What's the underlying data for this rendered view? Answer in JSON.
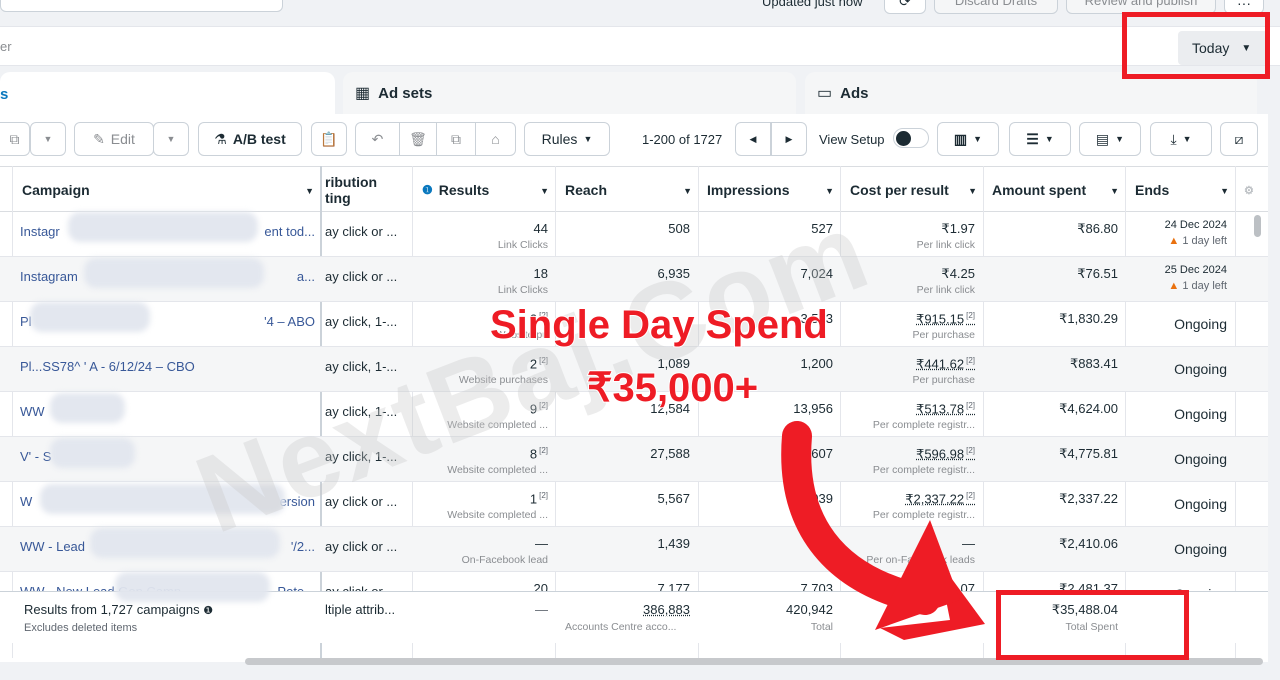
{
  "topbar": {
    "updated_text": "Updated just now",
    "discard_label": "Discard Drafts",
    "review_label": "Review and publish",
    "more_label": "···"
  },
  "filter": {
    "placeholder_fragment": "er",
    "date_label": "Today"
  },
  "tabs": {
    "campaigns_label": "s",
    "adsets_label": "Ad sets",
    "ads_label": "Ads"
  },
  "toolbar": {
    "edit_label": "Edit",
    "ab_test_label": "A/B test",
    "rules_label": "Rules",
    "pagination": "1-200 of 1727",
    "view_setup_label": "View Setup"
  },
  "columns": {
    "campaign": "Campaign",
    "attribution_line1": "ribution",
    "attribution_line2": "ting",
    "results": "Results",
    "reach": "Reach",
    "impressions": "Impressions",
    "cost_per_result": "Cost per result",
    "amount_spent": "Amount spent",
    "ends": "Ends"
  },
  "rows": [
    {
      "name": "Instagr",
      "name_tail": "ent tod...",
      "attr": "ay click or ...",
      "results": "44",
      "results_sub": "Link Clicks",
      "reach": "508",
      "impressions": "527",
      "cpr": "₹1.97",
      "cpr_sub": "Per link click",
      "spent": "₹86.80",
      "ends_date": "24 Dec 2024",
      "ends_left": "1 day left"
    },
    {
      "name": "Instagram",
      "name_tail": "a...",
      "attr": "ay click or ...",
      "results": "18",
      "results_sub": "Link Clicks",
      "reach": "6,935",
      "impressions": "7,024",
      "cpr": "₹4.25",
      "cpr_sub": "Per link click",
      "spent": "₹76.51",
      "ends_date": "25 Dec 2024",
      "ends_left": "1 day left"
    },
    {
      "name": "Pl",
      "name_tail": "'4 – ABO",
      "attr": "ay click, 1-...",
      "results": "2",
      "results_sub": "Website pu",
      "reach": "",
      "impressions": "3,553",
      "cpr": "₹915.15",
      "cpr_sub": "Per purchase",
      "spent": "₹1,830.29",
      "ends": "Ongoing"
    },
    {
      "name": "Pl...SS78^ ' A - 6/12/24 – CBO",
      "name_tail": "",
      "attr": "ay click, 1-...",
      "results": "2",
      "results_sub": "Website purchases",
      "reach": "1,089",
      "impressions": "1,200",
      "cpr": "₹441.62",
      "cpr_sub": "Per purchase",
      "spent": "₹883.41",
      "ends": "Ongoing"
    },
    {
      "name": "WW",
      "name_tail": "",
      "attr": "ay click, 1-...",
      "results": "9",
      "results_sub": "Website completed ...",
      "reach": "12,584",
      "impressions": "13,956",
      "cpr": "₹513.78",
      "cpr_sub": "Per complete registr...",
      "spent": "₹4,624.00",
      "ends": "Ongoing"
    },
    {
      "name": "V' - S",
      "name_tail": "",
      "attr": "ay click, 1-...",
      "results": "8",
      "results_sub": "Website completed ...",
      "reach": "27,588",
      "impressions": "32,607",
      "cpr": "₹596.98",
      "cpr_sub": "Per complete registr...",
      "spent": "₹4,775.81",
      "ends": "Ongoing"
    },
    {
      "name": "W",
      "name_tail": "ersion",
      "attr": "ay click or ...",
      "results": "1",
      "results_sub": "Website completed ...",
      "reach": "5,567",
      "impressions": "7,039",
      "cpr": "₹2,337.22",
      "cpr_sub": "Per complete registr...",
      "spent": "₹2,337.22",
      "ends": "Ongoing"
    },
    {
      "name": "WW - Lead",
      "name_tail": "'/2...",
      "attr": "ay click or ...",
      "results": "—",
      "results_sub": "On-Facebook lead",
      "reach": "1,439",
      "impressions": "",
      "cpr": "—",
      "cpr_sub": "Per on-Facebook leads",
      "spent": "₹2,410.06",
      "ends": "Ongoing"
    },
    {
      "name": "WW - New Lead Gen Camp",
      "name_tail": "Pote...",
      "attr": "ay click or ...",
      "results": "20",
      "results_sub": "",
      "reach": "7,177",
      "impressions": "7,703",
      "cpr": "₹124.07",
      "cpr_sub": "",
      "spent": "₹2,481.37",
      "ends": "Ongoing"
    }
  ],
  "totals": {
    "label": "Results from 1,727 campaigns",
    "sub": "Excludes deleted items",
    "attr": "ltiple attrib...",
    "results": "—",
    "reach": "386,883",
    "reach_sub": "Accounts Centre acco...",
    "impressions": "420,942",
    "impressions_sub": "Total",
    "cpr": "—",
    "spent": "₹35,488.04",
    "spent_sub": "Total Spent"
  },
  "overlay": {
    "headline1": "Single Day Spend",
    "headline2": "₹35,000+",
    "watermark": "NextBaj.Com",
    "accent_color": "#ee1c25"
  }
}
